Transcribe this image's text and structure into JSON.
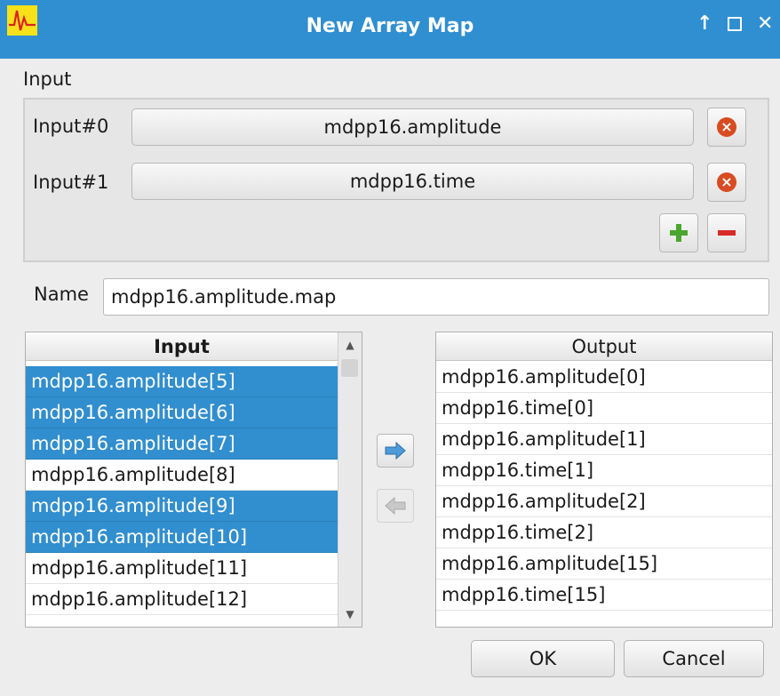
{
  "window": {
    "title": "New  Array Map",
    "icon": "waveform-app-icon",
    "controls": [
      "maximize",
      "restore",
      "close"
    ]
  },
  "input_section": {
    "label": "Input",
    "inputs": [
      {
        "label": "Input#0",
        "value": "mdpp16.amplitude"
      },
      {
        "label": "Input#1",
        "value": "mdpp16.time"
      }
    ],
    "icons": {
      "remove": "remove-circle-icon",
      "add": "plus-icon",
      "minus": "minus-icon"
    }
  },
  "name": {
    "label": "Name",
    "value": "mdpp16.amplitude.map"
  },
  "input_list": {
    "header": "Input",
    "items": [
      {
        "text": "mdpp16.amplitude[5]",
        "selected": true
      },
      {
        "text": "mdpp16.amplitude[6]",
        "selected": true
      },
      {
        "text": "mdpp16.amplitude[7]",
        "selected": true
      },
      {
        "text": "mdpp16.amplitude[8]",
        "selected": false
      },
      {
        "text": "mdpp16.amplitude[9]",
        "selected": true
      },
      {
        "text": "mdpp16.amplitude[10]",
        "selected": true
      },
      {
        "text": "mdpp16.amplitude[11]",
        "selected": false
      },
      {
        "text": "mdpp16.amplitude[12]",
        "selected": false
      }
    ]
  },
  "output_list": {
    "header": "Output",
    "items": [
      "mdpp16.amplitude[0]",
      "mdpp16.time[0]",
      "mdpp16.amplitude[1]",
      "mdpp16.time[1]",
      "mdpp16.amplitude[2]",
      "mdpp16.time[2]",
      "mdpp16.amplitude[15]",
      "mdpp16.time[15]"
    ]
  },
  "move_buttons": {
    "right_icon": "arrow-right-icon",
    "left_icon": "arrow-left-icon"
  },
  "footer": {
    "ok": "OK",
    "cancel": "Cancel"
  },
  "colors": {
    "titlebar": "#2f8fd1",
    "selection": "#318ecf",
    "add": "#4aa52e",
    "remove": "#d84c22",
    "minus": "#d82a2a"
  }
}
